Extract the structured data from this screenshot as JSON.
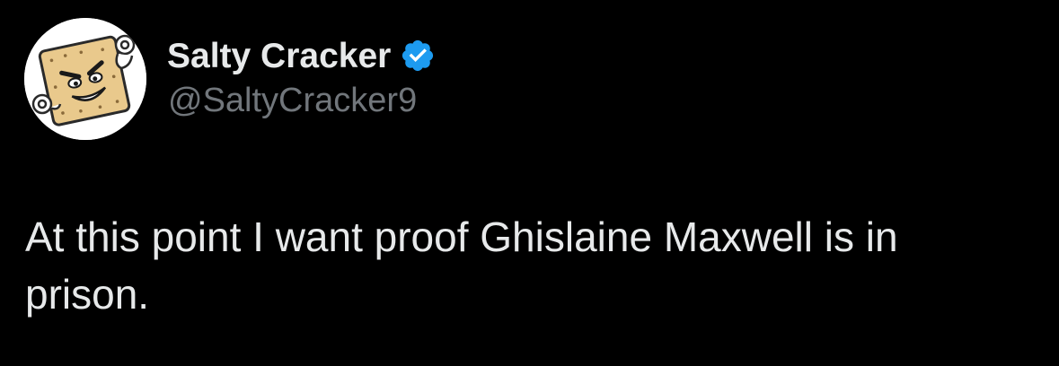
{
  "author": {
    "display_name": "Salty Cracker",
    "handle": "@SaltyCracker9",
    "verified": true,
    "verified_badge_color": "#1d9bf0",
    "avatar_icon": "cracker-cartoon-avatar"
  },
  "tweet": {
    "text": "At this point I want proof Ghislaine Maxwell is in prison."
  },
  "colors": {
    "background": "#000000",
    "primary_text": "#e7e9ea",
    "secondary_text": "#71767b"
  }
}
